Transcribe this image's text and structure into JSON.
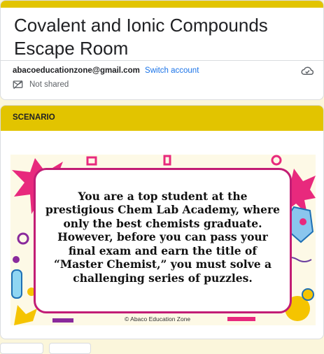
{
  "form": {
    "title": "Covalent and Ionic Compounds Escape Room",
    "account_email": "abacoeducationzone@gmail.com",
    "switch_account": "Switch account",
    "shared_status": "Not shared"
  },
  "section": {
    "header": "SCENARIO",
    "image_text": "You are a top student at the prestigious Chem Lab Academy, where only the best chemists graduate. However, before you can pass your final exam and earn the title of “Master Chemist,” you must solve a challenging series of puzzles.",
    "watermark": "© Abaco Education Zone"
  },
  "colors": {
    "accent": "#e2c400",
    "background": "#fbf6db",
    "frame_border": "#c21d75",
    "link": "#1a73e8"
  },
  "icons": [
    "cloud-save-icon",
    "mail-not-shared-icon"
  ]
}
